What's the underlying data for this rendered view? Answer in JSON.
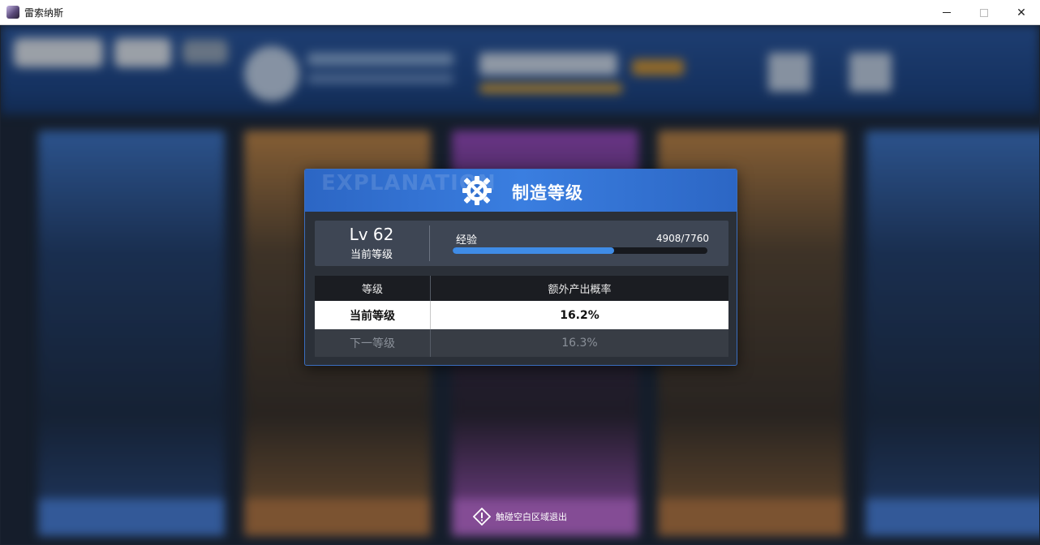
{
  "window": {
    "title": "雷索纳斯",
    "minimize_icon": "minimize-icon",
    "maximize_icon": "maximize-icon",
    "close_icon": "close-icon",
    "close_glyph": "✕"
  },
  "modal": {
    "watermark": "EXPLANATION",
    "title": "制造等级",
    "icon": "gear-wrench-icon",
    "level": {
      "value": "Lv 62",
      "caption": "当前等级"
    },
    "experience": {
      "label": "经验",
      "value": "4908/7760",
      "current": 4908,
      "max": 7760
    },
    "table": {
      "headers": [
        "等级",
        "额外产出概率"
      ],
      "rows": [
        {
          "level": "当前等级",
          "rate": "16.2%"
        },
        {
          "level": "下一等级",
          "rate": "16.3%"
        }
      ]
    }
  },
  "hint": {
    "icon": "warning-icon",
    "text": "触碰空白区域退出"
  },
  "colors": {
    "header_blue": "#2c66c4",
    "bar_fill": "#3f8ce6",
    "panel": "#3e4654"
  }
}
